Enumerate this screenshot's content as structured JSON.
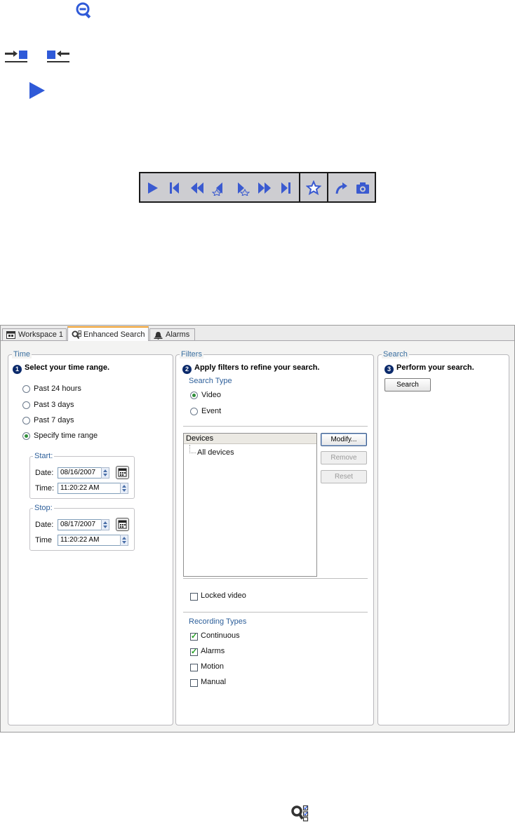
{
  "icons": {
    "zoom_out": "zoom-out-icon",
    "dock_right": "dock-right-icon",
    "dock_left": "dock-left-icon",
    "play": "play-icon"
  },
  "tabs": [
    {
      "label": "Workspace 1",
      "icon": "workspace-icon"
    },
    {
      "label": "Enhanced Search",
      "icon": "enhanced-search-icon",
      "active": true
    },
    {
      "label": "Alarms",
      "icon": "bell-icon"
    }
  ],
  "time": {
    "title": "Time",
    "step_num": "1",
    "step_text": "Select your time range.",
    "options": [
      "Past 24 hours",
      "Past 3 days",
      "Past 7 days",
      "Specify time range"
    ],
    "selected": "Specify time range",
    "start": {
      "title": "Start:",
      "date_label": "Date:",
      "date": "08/16/2007",
      "time_label": "Time:",
      "time": "11:20:22 AM"
    },
    "stop": {
      "title": "Stop:",
      "date_label": "Date:",
      "date": "08/17/2007",
      "time_label": "Time",
      "time": "11:20:22 AM"
    }
  },
  "filters": {
    "title": "Filters",
    "step_num": "2",
    "step_text": "Apply filters to refine your search.",
    "search_type_title": "Search Type",
    "search_types": [
      "Video",
      "Event"
    ],
    "search_type_selected": "Video",
    "devices_header": "Devices",
    "devices": [
      "All devices"
    ],
    "modify_label": "Modify...",
    "remove_label": "Remove",
    "reset_label": "Reset",
    "locked_video_label": "Locked video",
    "locked_video": false,
    "recording_types_title": "Recording Types",
    "recording_types": [
      {
        "label": "Continuous",
        "checked": true
      },
      {
        "label": "Alarms",
        "checked": true
      },
      {
        "label": "Motion",
        "checked": false
      },
      {
        "label": "Manual",
        "checked": false
      }
    ]
  },
  "search": {
    "title": "Search",
    "step_num": "3",
    "step_text": "Perform your search.",
    "button_label": "Search"
  },
  "colors": {
    "accent": "#0b2a6b",
    "icon_blue": "#2f5ad8",
    "tab_highlight": "#f0a030"
  }
}
